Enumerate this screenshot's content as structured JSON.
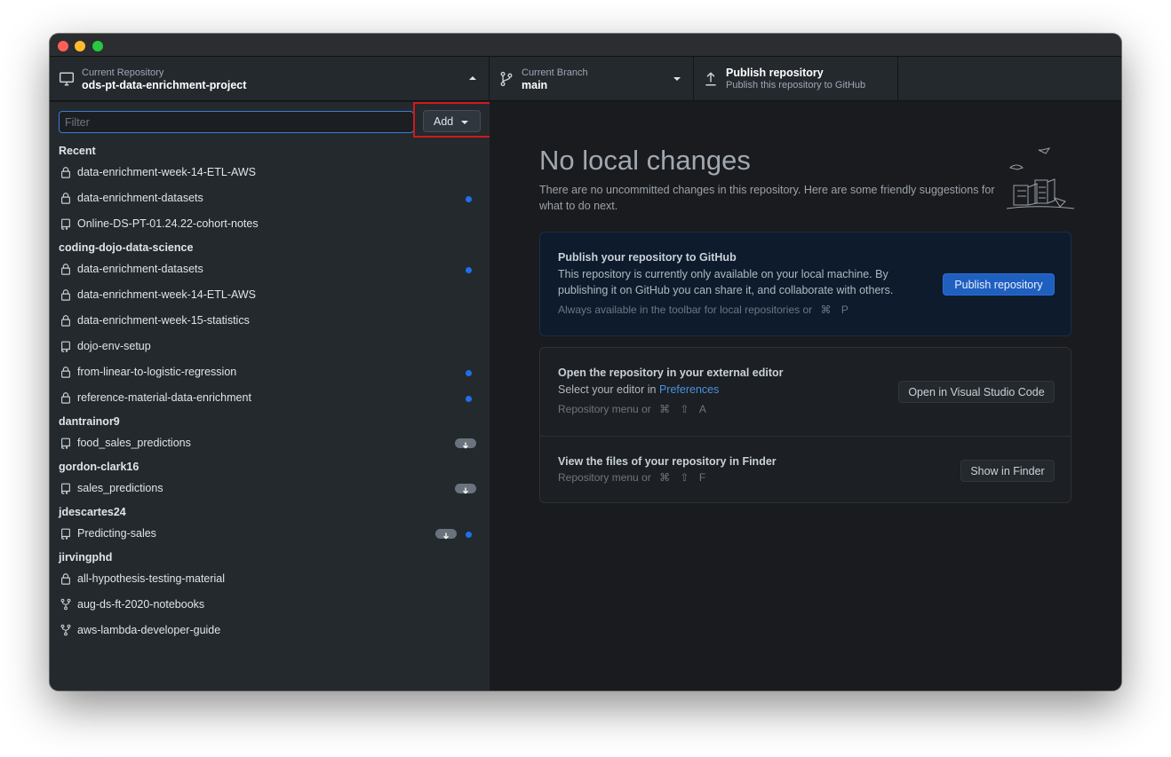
{
  "toolbar": {
    "repo_label": "Current Repository",
    "repo_name": "ods-pt-data-enrichment-project",
    "branch_label": "Current Branch",
    "branch_name": "main",
    "publish_title": "Publish repository",
    "publish_sub": "Publish this repository to GitHub"
  },
  "sidebar": {
    "filter_placeholder": "Filter",
    "add_label": "Add",
    "groups": [
      {
        "title": "Recent",
        "items": [
          {
            "name": "data-enrichment-week-14-ETL-AWS",
            "icon": "lock-icon"
          },
          {
            "name": "data-enrichment-datasets",
            "icon": "lock-icon",
            "dot": true
          },
          {
            "name": "Online-DS-PT-01.24.22-cohort-notes",
            "icon": "repo-icon"
          }
        ]
      },
      {
        "title": "coding-dojo-data-science",
        "items": [
          {
            "name": "data-enrichment-datasets",
            "icon": "lock-icon",
            "dot": true
          },
          {
            "name": "data-enrichment-week-14-ETL-AWS",
            "icon": "lock-icon"
          },
          {
            "name": "data-enrichment-week-15-statistics",
            "icon": "lock-icon"
          },
          {
            "name": "dojo-env-setup",
            "icon": "repo-icon"
          },
          {
            "name": "from-linear-to-logistic-regression",
            "icon": "lock-icon",
            "dot": true
          },
          {
            "name": "reference-material-data-enrichment",
            "icon": "lock-icon",
            "dot": true
          }
        ]
      },
      {
        "title": "dantrainor9",
        "items": [
          {
            "name": "food_sales_predictions",
            "icon": "repo-icon",
            "pull": true
          }
        ]
      },
      {
        "title": "gordon-clark16",
        "items": [
          {
            "name": "sales_predictions",
            "icon": "repo-icon",
            "pull": true
          }
        ]
      },
      {
        "title": "jdescartes24",
        "items": [
          {
            "name": "Predicting-sales",
            "icon": "repo-icon",
            "pull": true,
            "dot": true
          }
        ]
      },
      {
        "title": "jirvingphd",
        "items": [
          {
            "name": "all-hypothesis-testing-material",
            "icon": "lock-icon"
          },
          {
            "name": "aug-ds-ft-2020-notebooks",
            "icon": "fork-icon"
          },
          {
            "name": "aws-lambda-developer-guide",
            "icon": "fork-icon"
          }
        ]
      }
    ]
  },
  "main": {
    "headline": "No local changes",
    "subtext": "There are no uncommitted changes in this repository. Here are some friendly suggestions for what to do next.",
    "publish_card": {
      "title": "Publish your repository to GitHub",
      "desc": "This repository is currently only available on your local machine. By publishing it on GitHub you can share it, and collaborate with others.",
      "hint": "Always available in the toolbar for local repositories or",
      "keys": [
        "⌘",
        "P"
      ],
      "button": "Publish repository"
    },
    "editor_card": {
      "title": "Open the repository in your external editor",
      "desc_prefix": "Select your editor in",
      "desc_link": "Preferences",
      "hint": "Repository menu or",
      "keys": [
        "⌘",
        "⇧",
        "A"
      ],
      "button": "Open in Visual Studio Code"
    },
    "finder_card": {
      "title": "View the files of your repository in Finder",
      "hint": "Repository menu or",
      "keys": [
        "⌘",
        "⇧",
        "F"
      ],
      "button": "Show in Finder"
    }
  },
  "colors": {
    "accent": "#1f6feb",
    "highlight": "#d0191b",
    "close": "#ff5f57",
    "minimize": "#febc2e",
    "maximize": "#28c840"
  }
}
